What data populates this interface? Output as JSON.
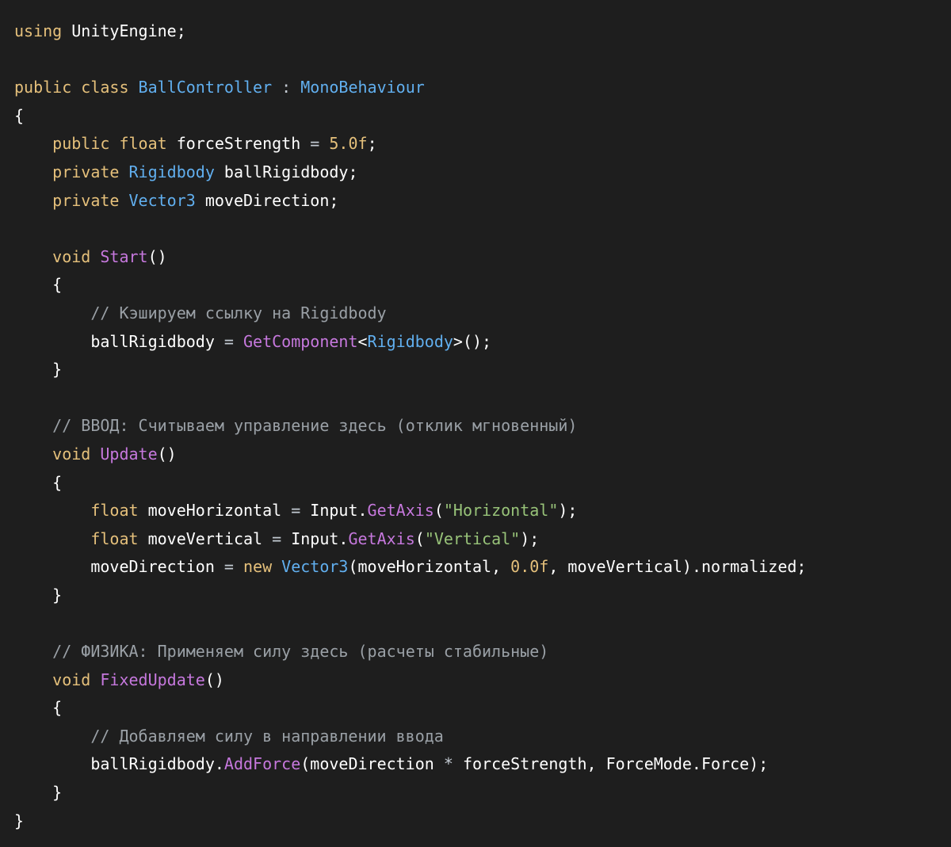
{
  "colors": {
    "background": "#1e1e1e",
    "plain": "#ffffff",
    "keyword": "#e5c07b",
    "type": "#61afef",
    "function": "#c678dd",
    "number": "#e5c07b",
    "string": "#98c379",
    "comment": "#9aa0a6",
    "operator": "#c3cad2"
  },
  "code": {
    "language": "csharp",
    "lines": [
      [
        {
          "t": "kw",
          "v": "using"
        },
        {
          "t": "pl",
          "v": " UnityEngine;"
        }
      ],
      [],
      [
        {
          "t": "kw",
          "v": "public class"
        },
        {
          "t": "pl",
          "v": " "
        },
        {
          "t": "typ",
          "v": "BallController"
        },
        {
          "t": "pl",
          "v": " "
        },
        {
          "t": "op",
          "v": ":"
        },
        {
          "t": "pl",
          "v": " "
        },
        {
          "t": "typ",
          "v": "MonoBehaviour"
        }
      ],
      [
        {
          "t": "pl",
          "v": "{"
        }
      ],
      [
        {
          "t": "pl",
          "v": "    "
        },
        {
          "t": "kw",
          "v": "public float"
        },
        {
          "t": "pl",
          "v": " forceStrength "
        },
        {
          "t": "op",
          "v": "="
        },
        {
          "t": "pl",
          "v": " "
        },
        {
          "t": "num",
          "v": "5.0f"
        },
        {
          "t": "pl",
          "v": ";"
        }
      ],
      [
        {
          "t": "pl",
          "v": "    "
        },
        {
          "t": "kw",
          "v": "private"
        },
        {
          "t": "pl",
          "v": " "
        },
        {
          "t": "typ",
          "v": "Rigidbody"
        },
        {
          "t": "pl",
          "v": " ballRigidbody;"
        }
      ],
      [
        {
          "t": "pl",
          "v": "    "
        },
        {
          "t": "kw",
          "v": "private"
        },
        {
          "t": "pl",
          "v": " "
        },
        {
          "t": "typ",
          "v": "Vector3"
        },
        {
          "t": "pl",
          "v": " moveDirection;"
        }
      ],
      [],
      [
        {
          "t": "pl",
          "v": "    "
        },
        {
          "t": "kw",
          "v": "void"
        },
        {
          "t": "pl",
          "v": " "
        },
        {
          "t": "fn",
          "v": "Start"
        },
        {
          "t": "pl",
          "v": "()"
        }
      ],
      [
        {
          "t": "pl",
          "v": "    {"
        }
      ],
      [
        {
          "t": "pl",
          "v": "        "
        },
        {
          "t": "cm",
          "v": "// Кэшируем ссылку на Rigidbody"
        }
      ],
      [
        {
          "t": "pl",
          "v": "        ballRigidbody "
        },
        {
          "t": "op",
          "v": "="
        },
        {
          "t": "pl",
          "v": " "
        },
        {
          "t": "fn",
          "v": "GetComponent"
        },
        {
          "t": "pl",
          "v": "<"
        },
        {
          "t": "typ",
          "v": "Rigidbody"
        },
        {
          "t": "pl",
          "v": ">();"
        }
      ],
      [
        {
          "t": "pl",
          "v": "    }"
        }
      ],
      [],
      [
        {
          "t": "pl",
          "v": "    "
        },
        {
          "t": "cm",
          "v": "// ВВОД: Считываем управление здесь (отклик мгновенный)"
        }
      ],
      [
        {
          "t": "pl",
          "v": "    "
        },
        {
          "t": "kw",
          "v": "void"
        },
        {
          "t": "pl",
          "v": " "
        },
        {
          "t": "fn",
          "v": "Update"
        },
        {
          "t": "pl",
          "v": "()"
        }
      ],
      [
        {
          "t": "pl",
          "v": "    {"
        }
      ],
      [
        {
          "t": "pl",
          "v": "        "
        },
        {
          "t": "kw",
          "v": "float"
        },
        {
          "t": "pl",
          "v": " moveHorizontal "
        },
        {
          "t": "op",
          "v": "="
        },
        {
          "t": "pl",
          "v": " Input."
        },
        {
          "t": "fn",
          "v": "GetAxis"
        },
        {
          "t": "pl",
          "v": "("
        },
        {
          "t": "str",
          "v": "\"Horizontal\""
        },
        {
          "t": "pl",
          "v": ");"
        }
      ],
      [
        {
          "t": "pl",
          "v": "        "
        },
        {
          "t": "kw",
          "v": "float"
        },
        {
          "t": "pl",
          "v": " moveVertical "
        },
        {
          "t": "op",
          "v": "="
        },
        {
          "t": "pl",
          "v": " Input."
        },
        {
          "t": "fn",
          "v": "GetAxis"
        },
        {
          "t": "pl",
          "v": "("
        },
        {
          "t": "str",
          "v": "\"Vertical\""
        },
        {
          "t": "pl",
          "v": ");"
        }
      ],
      [
        {
          "t": "pl",
          "v": "        moveDirection "
        },
        {
          "t": "op",
          "v": "="
        },
        {
          "t": "pl",
          "v": " "
        },
        {
          "t": "kw",
          "v": "new"
        },
        {
          "t": "pl",
          "v": " "
        },
        {
          "t": "typ",
          "v": "Vector3"
        },
        {
          "t": "pl",
          "v": "(moveHorizontal, "
        },
        {
          "t": "num",
          "v": "0.0f"
        },
        {
          "t": "pl",
          "v": ", moveVertical).normalized;"
        }
      ],
      [
        {
          "t": "pl",
          "v": "    }"
        }
      ],
      [],
      [
        {
          "t": "pl",
          "v": "    "
        },
        {
          "t": "cm",
          "v": "// ФИЗИКА: Применяем силу здесь (расчеты стабильные)"
        }
      ],
      [
        {
          "t": "pl",
          "v": "    "
        },
        {
          "t": "kw",
          "v": "void"
        },
        {
          "t": "pl",
          "v": " "
        },
        {
          "t": "fn",
          "v": "FixedUpdate"
        },
        {
          "t": "pl",
          "v": "()"
        }
      ],
      [
        {
          "t": "pl",
          "v": "    {"
        }
      ],
      [
        {
          "t": "pl",
          "v": "        "
        },
        {
          "t": "cm",
          "v": "// Добавляем силу в направлении ввода"
        }
      ],
      [
        {
          "t": "pl",
          "v": "        ballRigidbody."
        },
        {
          "t": "fn",
          "v": "AddForce"
        },
        {
          "t": "pl",
          "v": "(moveDirection "
        },
        {
          "t": "op",
          "v": "*"
        },
        {
          "t": "pl",
          "v": " forceStrength, ForceMode.Force);"
        }
      ],
      [
        {
          "t": "pl",
          "v": "    }"
        }
      ],
      [
        {
          "t": "pl",
          "v": "}"
        }
      ]
    ]
  }
}
